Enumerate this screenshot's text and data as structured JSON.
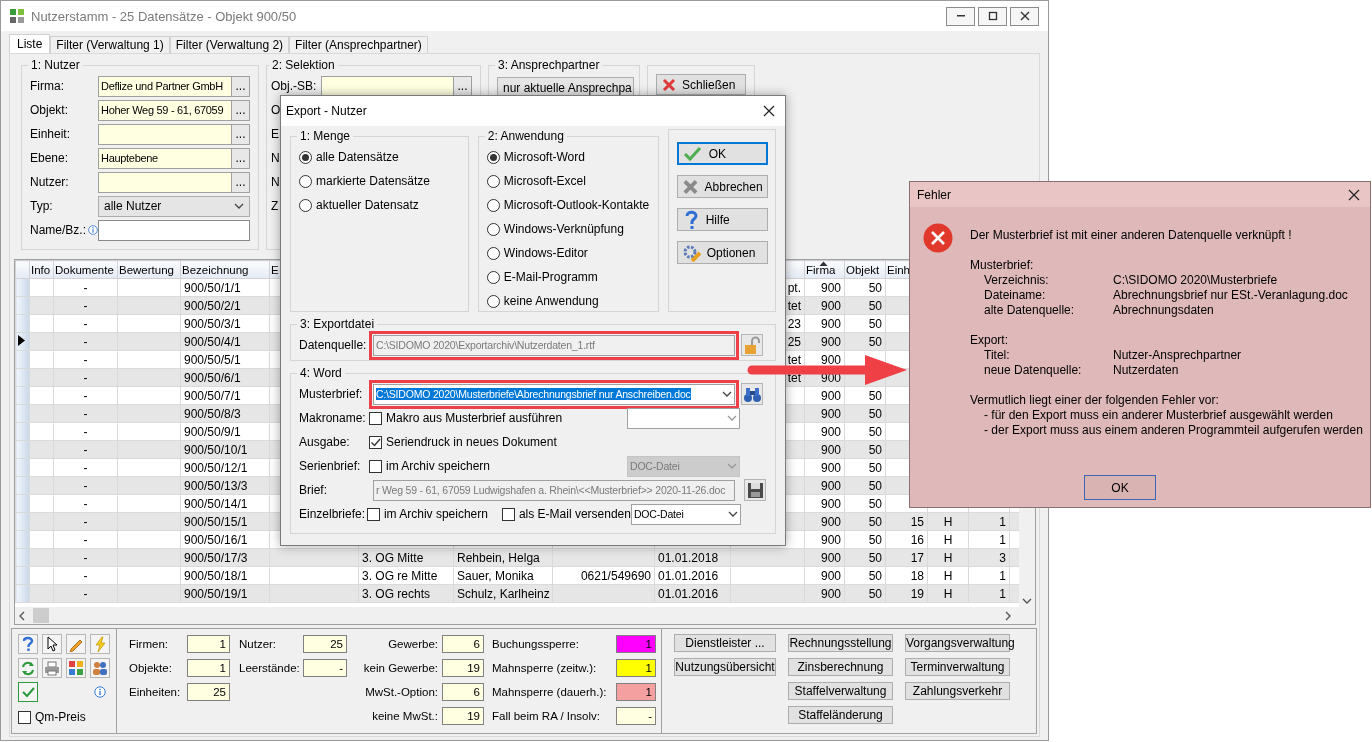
{
  "window": {
    "title": "Nutzerstamm - 25 Datensätze - Objekt 900/50"
  },
  "tabs": [
    {
      "label": "Liste",
      "selected": true
    },
    {
      "label": "Filter (Verwaltung 1)",
      "selected": false
    },
    {
      "label": "Filter (Verwaltung 2)",
      "selected": false
    },
    {
      "label": "Filter (Ansprechpartner)",
      "selected": false
    }
  ],
  "filters": {
    "nutzer": {
      "title": "1: Nutzer",
      "fields": [
        {
          "kind": "lookup",
          "label": "Firma:",
          "value": "Deflize und Partner GmbH",
          "button": "..."
        },
        {
          "kind": "lookup",
          "label": "Objekt:",
          "value": "Hoher Weg 59 - 61, 67059",
          "button": "..."
        },
        {
          "kind": "lookup",
          "label": "Einheit:",
          "button": "..."
        },
        {
          "kind": "lookup",
          "label": "Ebene:",
          "value": "Hauptebene",
          "button": "..."
        },
        {
          "kind": "lookup",
          "label": "Nutzer:",
          "button": "..."
        },
        {
          "kind": "select",
          "label": "Typ:",
          "value": "alle Nutzer"
        },
        {
          "kind": "text",
          "label": "Name/Bz.:",
          "info": true
        }
      ]
    },
    "selektion": {
      "title": "2: Selektion",
      "fields": [
        {
          "kind": "lookup",
          "label": "Obj.-SB:",
          "button": "..."
        }
      ],
      "cut_labels": [
        "O",
        "E",
        "N",
        "N",
        "Z"
      ]
    },
    "ansprechpartner": {
      "title": "3: Ansprechpartner",
      "value": "nur aktuelle Ansprechpa"
    },
    "close_button": {
      "label": "Schließen"
    }
  },
  "table": {
    "columns": [
      {
        "label": "Info",
        "sorted": false
      },
      {
        "label": "Dokumente",
        "sorted": false
      },
      {
        "label": "Bewertung",
        "sorted": false
      },
      {
        "label": "Bezeichnung",
        "sorted": false
      },
      {
        "label": "E",
        "sorted": false
      },
      {},
      {},
      {},
      {},
      {},
      {
        "label": "Firma",
        "sorted": true
      },
      {
        "label": "Objekt",
        "sorted": false
      },
      {
        "label": "Einh",
        "sorted": false
      },
      {},
      {},
      {}
    ],
    "rows": [
      {
        "current": false,
        "cells": [
          null,
          "-",
          null,
          "900/50/1/1",
          null,
          null,
          null,
          null,
          null,
          "pt.",
          "900",
          "50",
          null,
          null,
          null,
          null
        ]
      },
      {
        "current": false,
        "cells": [
          null,
          "-",
          null,
          "900/50/2/1",
          null,
          null,
          null,
          null,
          null,
          "tet",
          "900",
          "50",
          null,
          null,
          null,
          null
        ]
      },
      {
        "current": false,
        "cells": [
          null,
          "-",
          null,
          "900/50/3/1",
          null,
          null,
          null,
          null,
          null,
          "23",
          "900",
          "50",
          null,
          null,
          null,
          null
        ]
      },
      {
        "current": true,
        "cells": [
          null,
          "-",
          null,
          "900/50/4/1",
          null,
          null,
          null,
          null,
          null,
          "25",
          "900",
          "50",
          null,
          null,
          null,
          null
        ]
      },
      {
        "current": false,
        "cells": [
          null,
          "-",
          null,
          "900/50/5/1",
          null,
          null,
          null,
          null,
          null,
          "tet",
          "900",
          null,
          null,
          null,
          null,
          null
        ]
      },
      {
        "current": false,
        "cells": [
          null,
          "-",
          null,
          "900/50/6/1",
          null,
          null,
          null,
          null,
          null,
          "tet",
          "900",
          null,
          null,
          null,
          null,
          null
        ]
      },
      {
        "current": false,
        "cells": [
          null,
          "-",
          null,
          "900/50/7/1",
          null,
          null,
          null,
          null,
          null,
          null,
          "900",
          "50",
          null,
          null,
          null,
          null
        ]
      },
      {
        "current": false,
        "cells": [
          null,
          "-",
          null,
          "900/50/8/3",
          null,
          null,
          null,
          null,
          null,
          null,
          "900",
          "50",
          null,
          null,
          null,
          null
        ]
      },
      {
        "current": false,
        "cells": [
          null,
          "-",
          null,
          "900/50/9/1",
          null,
          null,
          null,
          null,
          null,
          null,
          "900",
          "50",
          null,
          null,
          null,
          null
        ]
      },
      {
        "current": false,
        "cells": [
          null,
          "-",
          null,
          "900/50/10/1",
          null,
          null,
          null,
          null,
          null,
          null,
          "900",
          "50",
          null,
          null,
          null,
          null
        ]
      },
      {
        "current": false,
        "cells": [
          null,
          "-",
          null,
          "900/50/12/1",
          null,
          null,
          null,
          null,
          null,
          null,
          "900",
          "50",
          null,
          null,
          null,
          null
        ]
      },
      {
        "current": false,
        "cells": [
          null,
          "-",
          null,
          "900/50/13/3",
          null,
          null,
          null,
          null,
          null,
          null,
          "900",
          "50",
          null,
          null,
          null,
          null
        ]
      },
      {
        "current": false,
        "cells": [
          null,
          "-",
          null,
          "900/50/14/1",
          null,
          null,
          null,
          null,
          null,
          null,
          "900",
          "50",
          null,
          null,
          null,
          null
        ]
      },
      {
        "current": false,
        "cells": [
          null,
          "-",
          null,
          "900/50/15/1",
          null,
          null,
          null,
          null,
          null,
          null,
          "900",
          "50",
          "15",
          "H",
          "1",
          null
        ]
      },
      {
        "current": false,
        "cells": [
          null,
          "-",
          null,
          "900/50/16/1",
          null,
          null,
          null,
          null,
          null,
          null,
          "900",
          "50",
          "16",
          "H",
          "1",
          null
        ]
      },
      {
        "current": false,
        "cells": [
          null,
          "-",
          null,
          "900/50/17/3",
          null,
          "3. OG Mitte",
          "Rehbein, Helga",
          null,
          "01.01.2018",
          null,
          "900",
          "50",
          "17",
          "H",
          "3",
          null
        ]
      },
      {
        "current": false,
        "cells": [
          null,
          "-",
          null,
          "900/50/18/1",
          null,
          "3. OG re Mitte",
          "Sauer, Monika",
          "0621/549690",
          "01.01.2016",
          null,
          "900",
          "50",
          "18",
          "H",
          "1",
          null
        ]
      },
      {
        "current": false,
        "cells": [
          null,
          "-",
          null,
          "900/50/19/1",
          null,
          "3. OG rechts",
          "Schulz, Karlheinz",
          null,
          "01.01.2016",
          null,
          "900",
          "50",
          "19",
          "H",
          "1",
          null
        ]
      }
    ]
  },
  "bottom": {
    "auto_toggle": {
      "checked": true
    },
    "qm_preis": {
      "label": "Qm-Preis",
      "checked": false
    },
    "counts": [
      [
        {
          "label": "Firmen:",
          "value": "1"
        },
        {
          "label": "Objekte:",
          "value": "1"
        },
        {
          "label": "Einheiten:",
          "value": "25"
        }
      ],
      [
        {
          "label": "Nutzer:",
          "value": "25"
        },
        {
          "label": "Leerstände:",
          "value": "-"
        }
      ],
      [
        {
          "label": "Gewerbe:",
          "value": "6"
        },
        {
          "label": "kein Gewerbe:",
          "value": "19"
        },
        {
          "label": "MwSt.-Option:",
          "value": "6"
        },
        {
          "label": "keine MwSt.:",
          "value": "19"
        }
      ],
      [
        {
          "label": "Buchungssperre:",
          "value": "1",
          "color": "#ff00ff"
        },
        {
          "label": "Mahnsperre (zeitw.):",
          "value": "1",
          "color": "#ffff00"
        },
        {
          "label": "Mahnsperre (dauerh.):",
          "value": "1",
          "color": "#f4a0a0"
        },
        {
          "label": "Fall beim RA / Insolv:",
          "value": "-",
          "color": "#ffffe1"
        }
      ]
    ],
    "buttons": [
      [
        "Dienstleister ...",
        "Nutzungsübersicht"
      ],
      [
        "Rechnungsstellung",
        "Zinsberechnung",
        "Staffelverwaltung",
        "Staffeländerung"
      ],
      [
        "Vorgangsverwaltung",
        "Terminverwaltung",
        "Zahlungsverkehr"
      ]
    ]
  },
  "export_dialog": {
    "title": "Export - Nutzer",
    "menge": {
      "title": "1: Menge",
      "options": [
        {
          "label": "alle Datensätze",
          "selected": true
        },
        {
          "label": "markierte Datensätze",
          "selected": false
        },
        {
          "label": "aktueller Datensatz",
          "selected": false
        }
      ]
    },
    "anwendung": {
      "title": "2: Anwendung",
      "options": [
        {
          "label": "Microsoft-Word",
          "selected": true
        },
        {
          "label": "Microsoft-Excel",
          "selected": false
        },
        {
          "label": "Microsoft-Outlook-Kontakte",
          "selected": false
        },
        {
          "label": "Windows-Verknüpfung",
          "selected": false
        },
        {
          "label": "Windows-Editor",
          "selected": false
        },
        {
          "label": "E-Mail-Programm",
          "selected": false
        },
        {
          "label": "keine Anwendung",
          "selected": false
        }
      ]
    },
    "buttons": [
      {
        "kind": "ok",
        "label": "OK",
        "default": true
      },
      {
        "kind": "cancel",
        "label": "Abbrechen",
        "default": false
      },
      {
        "kind": "help",
        "label": "Hilfe",
        "default": false
      },
      {
        "kind": "options",
        "label": "Optionen",
        "default": false
      }
    ],
    "exportdatei": {
      "title": "3: Exportdatei",
      "label": "Datenquelle:",
      "value": "C:\\SIDOMO 2020\\Exportarchiv\\Nutzerdaten_1.rtf",
      "disabled": true,
      "highlighted": true
    },
    "word": {
      "title": "4: Word",
      "rows": [
        {
          "kind": "template",
          "label": "Musterbrief:",
          "value": "C:\\SIDOMO 2020\\Musterbriefe\\Abrechnungsbrief nur Anschreiben.doc",
          "highlighted": true,
          "text_selected": true,
          "disabled": false
        },
        {
          "kind": "macro",
          "label": "Makroname:",
          "checkboxes": [
            {
              "label": "Makro aus Musterbrief ausführen",
              "checked": false
            }
          ],
          "select": {
            "disabled": false
          }
        },
        {
          "kind": "output",
          "label": "Ausgabe:",
          "checkboxes": [
            {
              "label": "Seriendruck in neues Dokument",
              "checked": true
            }
          ]
        },
        {
          "kind": "serial",
          "label": "Serienbrief:",
          "checkboxes": [
            {
              "label": "im Archiv speichern",
              "checked": false
            }
          ],
          "select": {
            "value": "DOC-Datei",
            "disabled": true
          }
        },
        {
          "kind": "letter",
          "label": "Brief:",
          "value": "r Weg 59 - 61, 67059 Ludwigshafen a. Rhein\\<<Musterbrief>> 2020-11-26.doc",
          "disabled": true
        },
        {
          "kind": "single",
          "label": "Einzelbriefe:",
          "checkboxes": [
            {
              "label": "im Archiv speichern",
              "checked": false
            },
            {
              "label": "als E-Mail versenden",
              "checked": false
            }
          ],
          "select": {
            "value": "DOC-Datei",
            "disabled": false
          }
        }
      ]
    }
  },
  "error_dialog": {
    "title": "Fehler",
    "message": "Der Musterbrief ist mit einer anderen Datenquelle verknüpft !",
    "sections": [
      {
        "heading": "Musterbrief:",
        "entries": [
          {
            "label": "Verzeichnis:",
            "value": "C:\\SIDOMO 2020\\Musterbriefe"
          },
          {
            "label": "Dateiname:",
            "value": "Abrechnungsbrief nur ESt.-Veranlagung.doc"
          },
          {
            "label": "alte Datenquelle:",
            "value": "Abrechnungsdaten"
          }
        ]
      },
      {
        "heading": "Export:",
        "entries": [
          {
            "label": "Titel:",
            "value": "Nutzer-Ansprechpartner"
          },
          {
            "label": "neue Datenquelle:",
            "value": "Nutzerdaten"
          }
        ]
      }
    ],
    "cause": "Vermutlich liegt einer der folgenden Fehler vor:",
    "causes": [
      "- für den Export muss ein anderer Musterbrief ausgewählt werden",
      "- der Export muss aus einem anderen Programmteil aufgerufen werden"
    ],
    "button": "OK"
  }
}
